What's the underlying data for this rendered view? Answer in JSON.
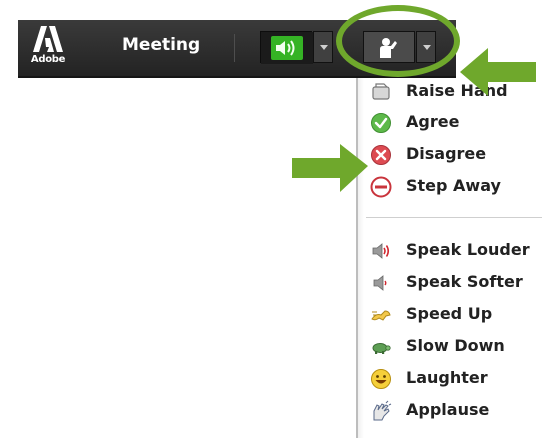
{
  "topbar": {
    "logo_text": "Adobe",
    "title": "Meeting"
  },
  "status_menu": {
    "groups": [
      [
        {
          "label": "Raise Hand",
          "icon": "raise-hand-icon"
        },
        {
          "label": "Agree",
          "icon": "agree-check-icon"
        },
        {
          "label": "Disagree",
          "icon": "disagree-x-icon"
        },
        {
          "label": "Step Away",
          "icon": "step-away-icon"
        }
      ],
      [
        {
          "label": "Speak Louder",
          "icon": "speak-louder-icon"
        },
        {
          "label": "Speak Softer",
          "icon": "speak-softer-icon"
        },
        {
          "label": "Speed Up",
          "icon": "speed-up-icon"
        },
        {
          "label": "Slow Down",
          "icon": "slow-down-icon"
        },
        {
          "label": "Laughter",
          "icon": "laughter-icon"
        },
        {
          "label": "Applause",
          "icon": "applause-icon"
        }
      ]
    ]
  },
  "colors": {
    "highlight": "#6fa82c",
    "speaker_green": "#3fbf2a",
    "agree_green": "#55b040",
    "disagree_red": "#d9434b"
  }
}
